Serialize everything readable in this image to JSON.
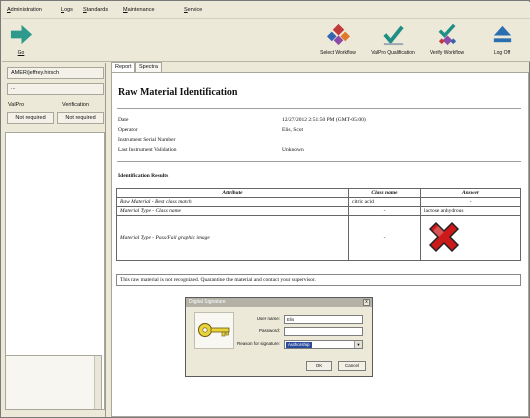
{
  "menu": [
    "Administration",
    "Logs",
    "Standards",
    "Maintenance",
    "Service"
  ],
  "toolbar": {
    "go_label": "Go",
    "select_workflow_label": "Select Workflow",
    "valpro_qualification_label": "ValPro Qualification",
    "verify_workflow_label": "Verify Workflow",
    "log_off_label": "Log Off"
  },
  "left_panel": {
    "user": "AMER/jeffrey.hirsch",
    "secondary": "...",
    "valpro_label": "ValPro",
    "verification_label": "Verification",
    "valpro_value": "Not required",
    "verification_value": "Not required"
  },
  "tabs": [
    "Report",
    "Spectra"
  ],
  "report": {
    "title": "Raw Material Identification",
    "fields": [
      {
        "label": "Date",
        "value": "12/27/2012 2:51:50 PM (GMT-05:00)"
      },
      {
        "label": "Operator",
        "value": "Elis, Scot"
      },
      {
        "label": "Instrument Serial Number",
        "value": ""
      },
      {
        "label": "Last Instrument Validation",
        "value": "Unknown"
      }
    ],
    "section_title": "Identification Results",
    "table_headers": {
      "attribute": "Attribute",
      "class_name": "Class name",
      "answer": "Answer"
    },
    "rows": [
      {
        "attribute": "Raw Material - Best class match",
        "class_name": "citric acid",
        "answer": "-"
      },
      {
        "attribute": "Material Type - Class name",
        "class_name": "-",
        "answer": "lactose anhydrous"
      },
      {
        "attribute": "Material Type - Pass/Fail graphic image",
        "class_name": "-",
        "answer": ""
      }
    ],
    "message": "This raw material is not recognized. Quarantine the material and contact your supervisor."
  },
  "dialog": {
    "title": "Digital Signature",
    "close": "x",
    "user_name_label": "User name:",
    "user_name_value": "Elis",
    "password_label": "Password:",
    "password_value": "",
    "reason_label": "Reason for signature:",
    "reason_value": "Authorship",
    "ok_label": "OK",
    "cancel_label": "Cancel"
  },
  "colors": {
    "go_arrow": "#2e9a8c",
    "check_teal": "#1f8f86",
    "fail_red": "#cc1a1a",
    "logoff_blue": "#2a6fb0",
    "key_yellow": "#e8d33a"
  }
}
